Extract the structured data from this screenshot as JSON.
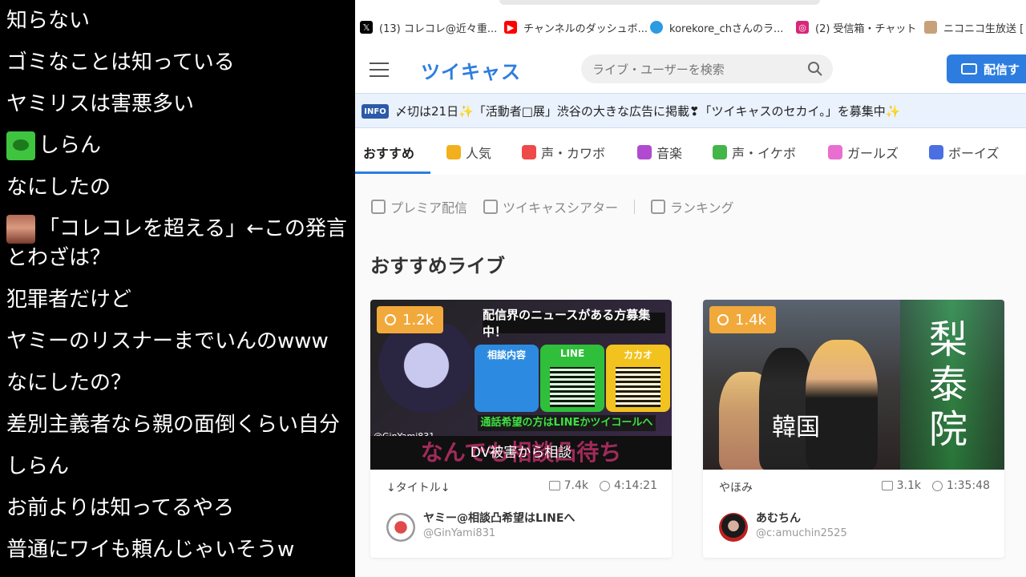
{
  "chat": {
    "lines": [
      {
        "text": "知らない"
      },
      {
        "text": "ゴミなことは知っている"
      },
      {
        "text": "ヤミリスは害悪多い"
      },
      {
        "text": "しらん"
      },
      {
        "text": "なにしたの"
      },
      {
        "text": "「コレコレを超える」←この発言"
      },
      {
        "text": "とわざは？"
      },
      {
        "text": "犯罪者だけど"
      },
      {
        "text": "ヤミーのリスナーまでいんのwww"
      },
      {
        "text": "なにしたの？"
      },
      {
        "text": "差別主義者なら親の面倒くらい自分"
      },
      {
        "text": "しらん"
      },
      {
        "text": "お前よりは知ってるやろ"
      },
      {
        "text": "普通にワイも頼んじゃいそうw"
      }
    ]
  },
  "bookmarks": [
    {
      "label": "(13) コレコレ@近々重...",
      "icon": "x-icon",
      "color": "#000000"
    },
    {
      "label": "チャンネルのダッシュボ...",
      "icon": "youtube-icon",
      "color": "#ff0000"
    },
    {
      "label": "korekore_chさんのラ...",
      "icon": "twitcasting-icon",
      "color": "#2d9be0"
    },
    {
      "label": "(2) 受信箱・チャット",
      "icon": "instagram-icon",
      "color": "#d6287a"
    },
    {
      "label": "ニコニコ生放送 [リ",
      "icon": "niconico-icon",
      "color": "#c8a07a"
    }
  ],
  "header": {
    "logo": "ツイキャス",
    "search_placeholder": "ライブ・ユーザーを検索",
    "broadcast_label": "配信す"
  },
  "info": {
    "badge": "INFO",
    "text": "〆切は21日✨「活動者□展」渋谷の大きな広告に掲載❣「ツイキャスのセカイ。」を募集中✨"
  },
  "tabs": [
    {
      "label": "おすすめ",
      "icon": "",
      "color": "",
      "active": true
    },
    {
      "label": "人気",
      "icon": "crown-icon",
      "color": "#f2b01e"
    },
    {
      "label": "声・カワボ",
      "icon": "heart-icon",
      "color": "#ee4a4a"
    },
    {
      "label": "音楽",
      "icon": "music-icon",
      "color": "#b04bd1"
    },
    {
      "label": "声・イケボ",
      "icon": "monitor-icon",
      "color": "#44b548"
    },
    {
      "label": "ガールズ",
      "icon": "girls-icon",
      "color": "#e86fd0"
    },
    {
      "label": "ボーイズ",
      "icon": "boys-icon",
      "color": "#4b6fe0"
    }
  ],
  "subnav": {
    "premier": "プレミア配信",
    "theater": "ツイキャスシアター",
    "ranking": "ランキング"
  },
  "section_title": "おすすめライブ",
  "cards": [
    {
      "viewers": "1.2k",
      "title": "↓タイトル↓",
      "comments": "7.4k",
      "duration": "4:14:21",
      "name": "ヤミー@相談凸希望はLINEへ",
      "handle": "@GinYami831",
      "thumb": {
        "banner": "配信界のニュースがある方募集中！",
        "box1": "相談内容",
        "box2": "LINE",
        "box3": "カカオ",
        "callout": "通話希望の方はLINEかツイコールへ",
        "bottom": "なんでも相談凸待ち",
        "overlay": "DV被害から相談",
        "xhandle": "@GinYami831"
      }
    },
    {
      "viewers": "1.4k",
      "title": "やほみ",
      "comments": "3.1k",
      "duration": "1:35:48",
      "name": "あむちん",
      "handle": "@c:amuchin2525",
      "thumb": {
        "big": "梨泰院",
        "kr": "韓国"
      }
    }
  ]
}
